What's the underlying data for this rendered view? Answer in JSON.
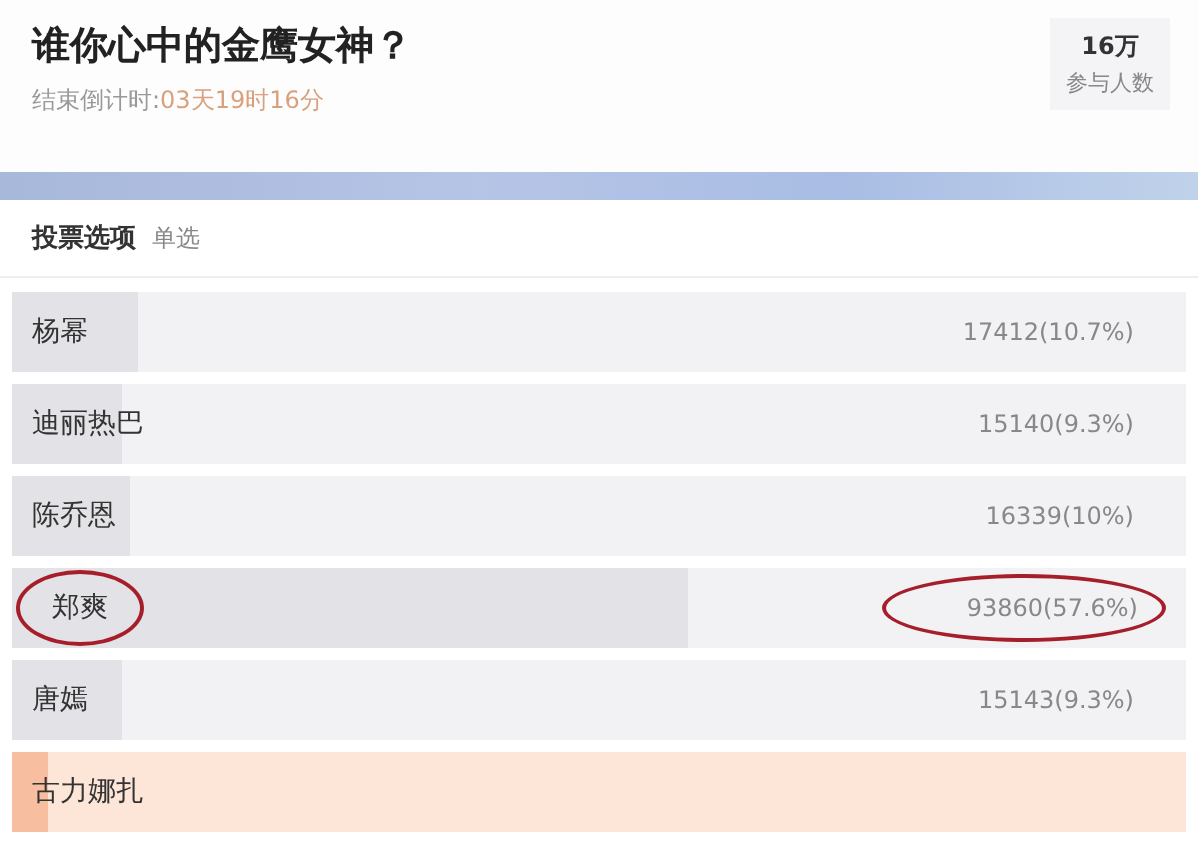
{
  "poll": {
    "title": "谁你心中的金鹰女神？",
    "countdown_label": "结束倒计时:",
    "countdown_value": "03天19时16分"
  },
  "participants": {
    "count": "16万",
    "label": "参与人数"
  },
  "options_header": {
    "title": "投票选项",
    "mode": "单选"
  },
  "options": [
    {
      "name": "杨幂",
      "result": "17412(10.7%)",
      "level": 0.107,
      "selected": false,
      "circled": false
    },
    {
      "name": "迪丽热巴",
      "result": "15140(9.3%)",
      "level": 0.093,
      "selected": false,
      "circled": false
    },
    {
      "name": "陈乔恩",
      "result": "16339(10%)",
      "level": 0.1,
      "selected": false,
      "circled": false
    },
    {
      "name": "郑爽",
      "result": "93860(57.6%)",
      "level": 0.576,
      "selected": false,
      "circled": true
    },
    {
      "name": "唐嫣",
      "result": "15143(9.3%)",
      "level": 0.093,
      "selected": false,
      "circled": false
    },
    {
      "name": "古力娜扎",
      "level": 0.03,
      "selected": true,
      "circled": false
    }
  ]
}
